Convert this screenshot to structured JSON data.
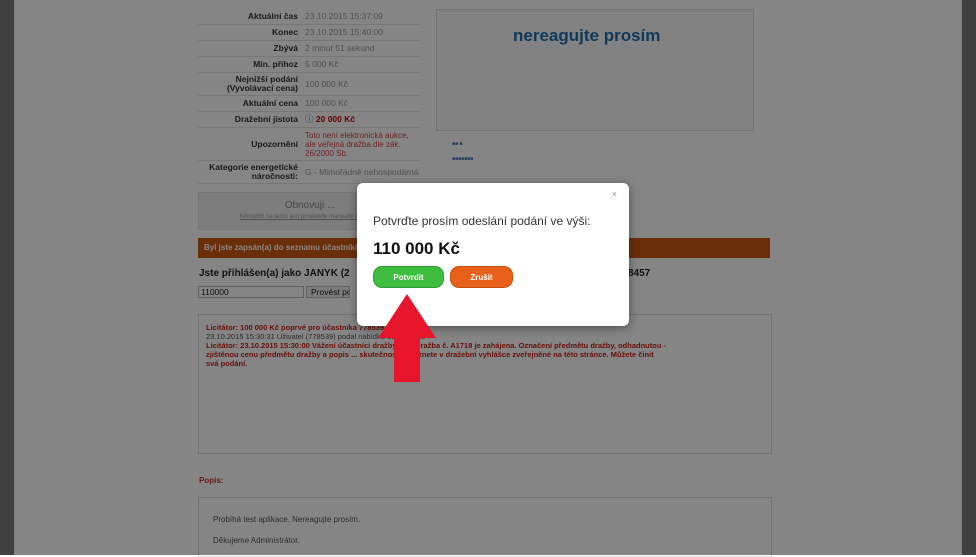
{
  "info_rows": [
    {
      "label": "Aktuální čas",
      "value": "23.10.2015 15:37:09"
    },
    {
      "label": "Konec",
      "value": "23.10.2015 15:40:00"
    },
    {
      "label": "Zbývá",
      "value": "2 minut 51 sekund"
    },
    {
      "label": "Min. příhoz",
      "value": "5 000 Kč"
    },
    {
      "label": "Nejnižší podání (Vyvolávací cena)",
      "value": "100 000 Kč"
    },
    {
      "label": "Aktuální cena",
      "value": "100 000 Kč"
    },
    {
      "label": "Dražební jistota",
      "value": "20 000 Kč"
    },
    {
      "label": "Upozornění",
      "value": "Toto není elektronická aukce, ale veřejná dražba dle zák. 26/2000 Sb."
    },
    {
      "label": "Kategorie energetické náročnosti:",
      "value": "G - Mimořádně nehospodárná"
    }
  ],
  "banner_text": "nereagujte prosím",
  "refresh": {
    "text": "Obnovuji ...",
    "link": "Kliknutím na tento text provedete manuální obnovení"
  },
  "orange_bar_text": "Byl jste zapsán(a) do seznamu účastníků",
  "login": {
    "prefix": "Jste přihlášen(a) jako JANYK (2",
    "suffix": "8457"
  },
  "bid_input_value": "110000",
  "submit_label": "Provést podání",
  "log": {
    "line1": "Licitátor: 100 000 Kč poprvé pro účastníka 778539.",
    "line2": "23.10.2015 15:30:31 Uživatel (778539) podal nabídku 100 000 Kč",
    "line3": "Licitátor: 23.10.2015 15:30:00 Vážení účastníci dražby, tato dražba č. A1718 je zahájena. Označení předmětu dražby, odhadnutou -",
    "line4": "zjištěnou cenu předmětu dražby a popis ... skutečností naleznete v dražební vyhlášce zveřejněné na této stránce. Můžete činit",
    "line5": "svá podání."
  },
  "popis": {
    "label": "Popis:",
    "line1": "Probíhá test aplikace. Nereagujte prosím.",
    "line2": "Děkujeme Administrátor."
  },
  "modal": {
    "close_glyph": "×",
    "message": "Potvrďte prosím odeslání podání ve výši:",
    "amount": "110 000 Kč",
    "confirm_label": "Potvrdit",
    "cancel_label": "Zrušit"
  },
  "colors": {
    "confirm": "#3ebd3e",
    "cancel": "#e8611a",
    "arrow": "#e8162a",
    "orange_bar": "#cc5a10"
  }
}
